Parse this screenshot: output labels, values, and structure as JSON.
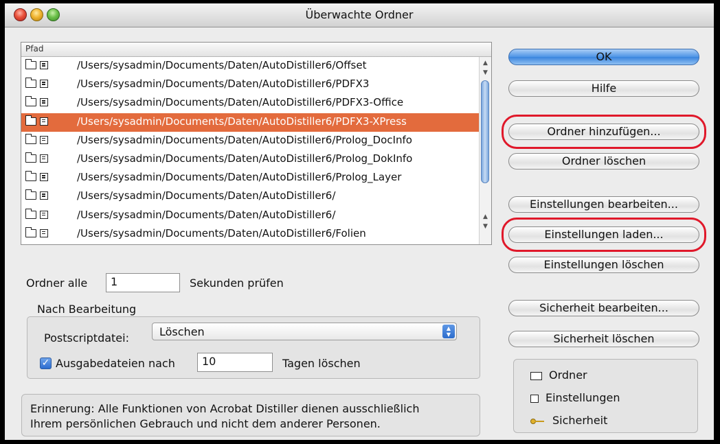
{
  "window": {
    "title": "Überwachte Ordner"
  },
  "list": {
    "column_header": "Pfad",
    "rows": [
      {
        "path": "/Users/sysadmin/Documents/Daten/AutoDistiller6/Offset",
        "selected": false
      },
      {
        "path": "/Users/sysadmin/Documents/Daten/AutoDistiller6/PDFX3",
        "selected": false
      },
      {
        "path": "/Users/sysadmin/Documents/Daten/AutoDistiller6/PDFX3-Office",
        "selected": false
      },
      {
        "path": "/Users/sysadmin/Documents/Daten/AutoDistiller6/PDFX3-XPress",
        "selected": true
      },
      {
        "path": "/Users/sysadmin/Documents/Daten/AutoDistiller6/Prolog_DocInfo",
        "selected": false
      },
      {
        "path": "/Users/sysadmin/Documents/Daten/AutoDistiller6/Prolog_DokInfo",
        "selected": false
      },
      {
        "path": "/Users/sysadmin/Documents/Daten/AutoDistiller6/Prolog_Layer",
        "selected": false
      },
      {
        "path": "/Users/sysadmin/Documents/Daten/AutoDistiller6/",
        "selected": false
      },
      {
        "path": "/Users/sysadmin/Documents/Daten/AutoDistiller6/",
        "selected": false
      },
      {
        "path": "/Users/sysadmin/Documents/Daten/AutoDistiller6/Folien",
        "selected": false
      }
    ]
  },
  "interval": {
    "prefix": "Ordner alle",
    "value": "1",
    "suffix": "Sekunden prüfen"
  },
  "after_processing": {
    "title": "Nach Bearbeitung",
    "postscript_label": "Postscriptdatei:",
    "postscript_value": "Löschen",
    "output_checkbox_label": "Ausgabedateien nach",
    "output_checked": true,
    "days_value": "10",
    "days_suffix": "Tagen löschen"
  },
  "notice": {
    "line1": "Erinnerung: Alle Funktionen von Acrobat Distiller dienen ausschließlich",
    "line2": "Ihrem persönlichen Gebrauch und nicht dem anderer Personen."
  },
  "buttons": {
    "ok": "OK",
    "help": "Hilfe",
    "add_folder": "Ordner hinzufügen...",
    "delete_folder": "Ordner löschen",
    "edit_settings": "Einstellungen bearbeiten...",
    "load_settings": "Einstellungen laden...",
    "delete_settings": "Einstellungen löschen",
    "edit_security": "Sicherheit bearbeiten...",
    "delete_security": "Sicherheit löschen"
  },
  "legend": {
    "folder": "Ordner",
    "settings": "Einstellungen",
    "security": "Sicherheit"
  },
  "icons": [
    "folder-icon",
    "settings-icon",
    "key-icon",
    "checkmark-icon",
    "chevron-up-icon",
    "chevron-down-icon"
  ],
  "colors": {
    "selection": "#e36b3d",
    "default_button": "#4d94e6",
    "highlight": "#e0182a"
  }
}
